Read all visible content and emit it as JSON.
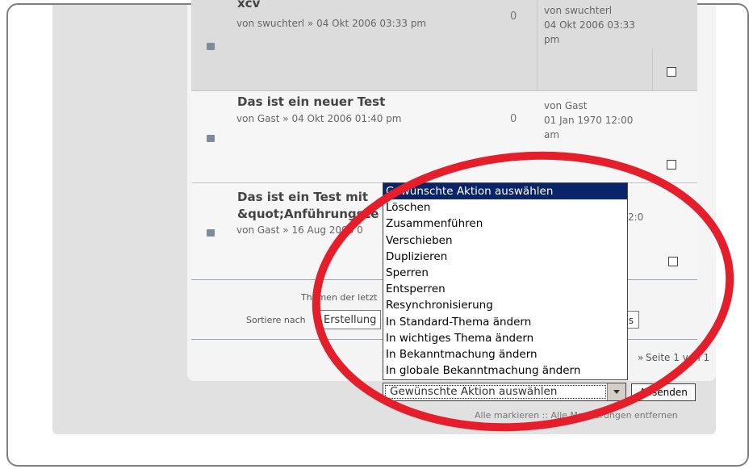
{
  "topics": [
    {
      "title": "xcv",
      "by": "von swuchterl » 04 Okt 2006 03:33 pm",
      "replies": "0",
      "last_by": "von swuchterl",
      "last_date_1": "04 Okt 2006 03:33",
      "last_date_2": "pm"
    },
    {
      "title": "Das ist ein neuer Test",
      "by": "von Gast » 04 Okt 2006 01:40 pm",
      "replies": "0",
      "last_by": "von Gast",
      "last_date_1": "01 Jan 1970 12:00",
      "last_date_2": "am"
    },
    {
      "title_line1": "Das ist ein Test mit",
      "title_line2": "&quot;Anführungsze",
      "by": "von Gast » 16 Aug 2006 0",
      "partial_time": "2:0"
    }
  ],
  "footer": {
    "themes_label": "Themen der letzt",
    "sort_label": "Sortiere nach",
    "sort_value": "Erstellung",
    "go_fragment": "s",
    "pagination": "Seite 1 von 1",
    "pagination_prefix": "»"
  },
  "action_select": {
    "selected": "Gewünschte Aktion auswählen",
    "options": [
      "Gewünschte Aktion auswählen",
      "Löschen",
      "Zusammenführen",
      "Verschieben",
      "Duplizieren",
      "Sperren",
      "Entsperren",
      "Resynchronisierung",
      "In Standard-Thema ändern",
      "In wichtiges Thema ändern",
      "In Bekanntmachung ändern",
      "In globale Bekanntmachung ändern"
    ]
  },
  "submit_label": "Absenden",
  "mark_links": "Alle markieren :: Alle Markierungen entfernen",
  "colors": {
    "highlight_ring": "#e41e2b",
    "selected_option_bg": "#0a246a"
  }
}
